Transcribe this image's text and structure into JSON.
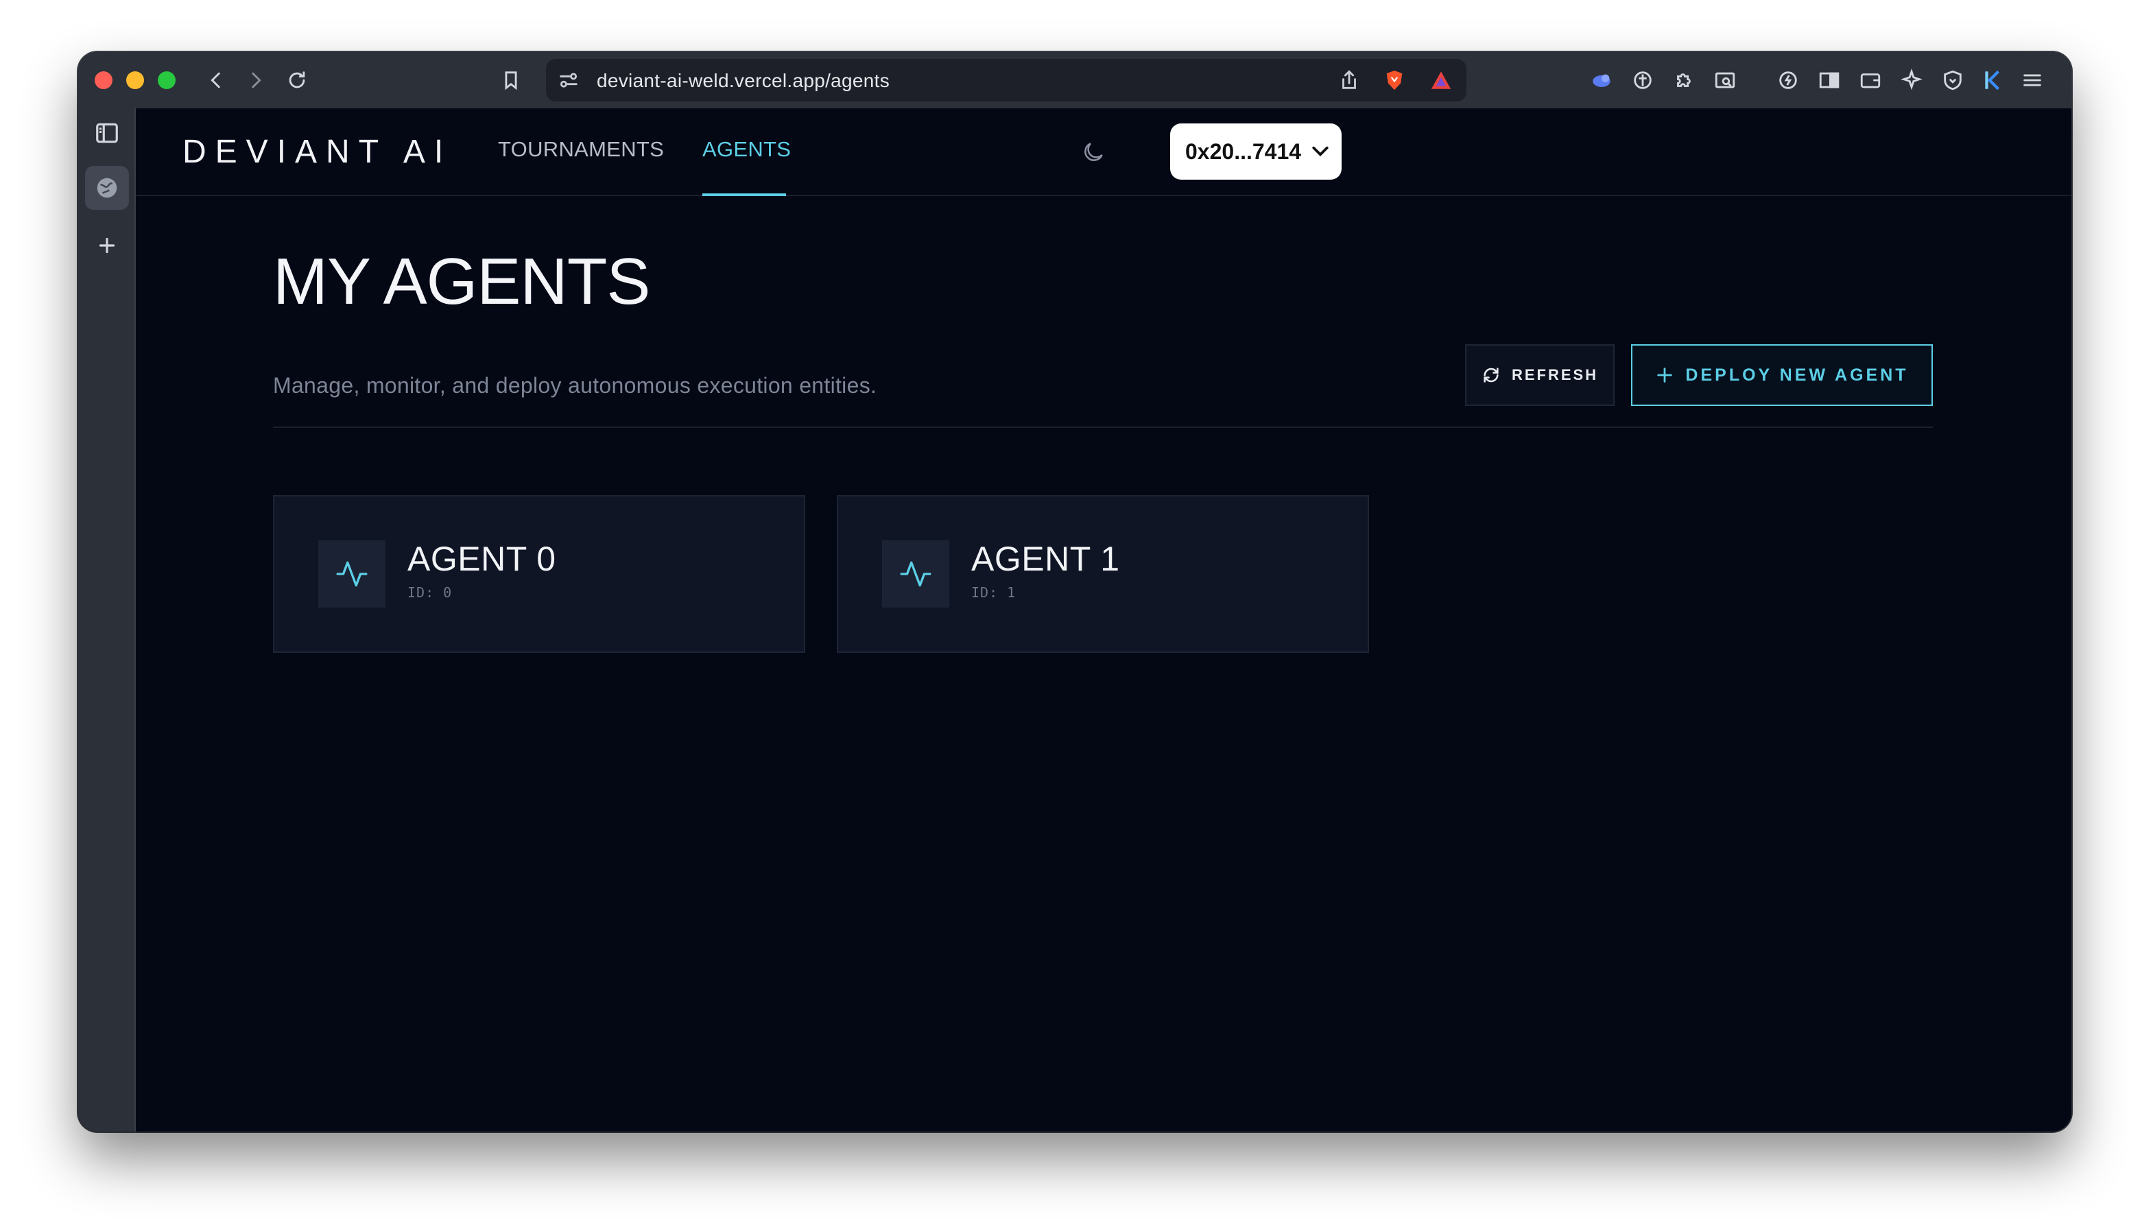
{
  "browser": {
    "url": "deviant-ai-weld.vercel.app/agents"
  },
  "app": {
    "logo": "DEVIANT AI",
    "nav": [
      {
        "label": "TOURNAMENTS",
        "active": false
      },
      {
        "label": "AGENTS",
        "active": true
      }
    ],
    "wallet_address": "0x20...7414",
    "accent_color": "#5ccfe6"
  },
  "page": {
    "title": "MY AGENTS",
    "subtitle": "Manage, monitor, and deploy autonomous execution entities.",
    "refresh_label": "REFRESH",
    "deploy_label": "DEPLOY NEW AGENT"
  },
  "agents": [
    {
      "name": "AGENT 0",
      "id": "ID: 0",
      "icon": "activity-pulse-icon"
    },
    {
      "name": "AGENT 1",
      "id": "ID: 1",
      "icon": "activity-pulse-icon"
    }
  ]
}
